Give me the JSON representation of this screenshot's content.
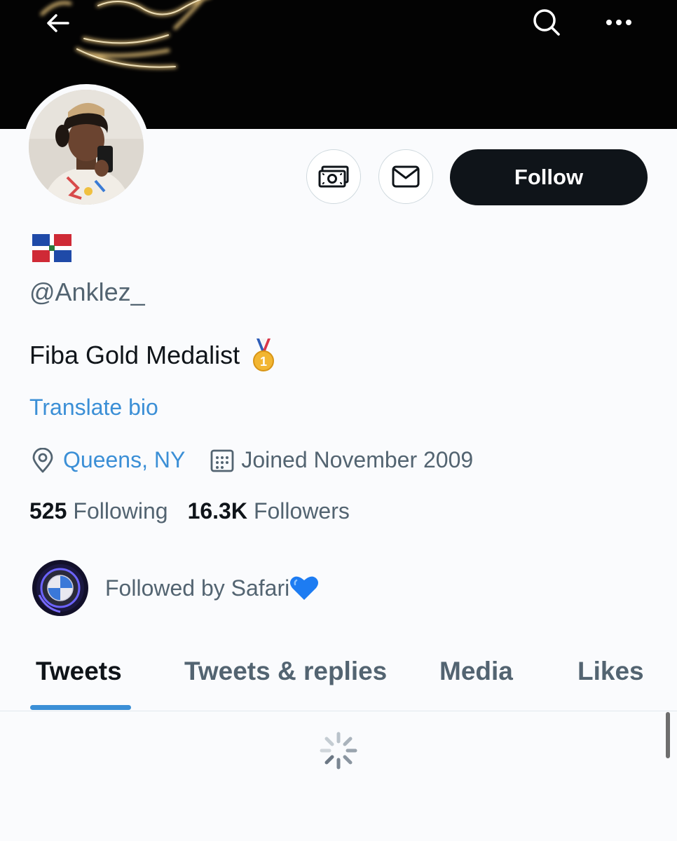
{
  "profile": {
    "handle": "@Anklez_",
    "bio": "Fiba Gold Medalist",
    "translate_label": "Translate bio",
    "location": "Queens, NY",
    "joined": "Joined November 2009",
    "following_count": "525",
    "following_label": "Following",
    "followers_count": "16.3K",
    "followers_label": "Followers",
    "followed_by": "Followed by Safari"
  },
  "actions": {
    "follow_label": "Follow"
  },
  "tabs": [
    {
      "label": "Tweets",
      "active": true
    },
    {
      "label": "Tweets & replies",
      "active": false
    },
    {
      "label": "Media",
      "active": false
    },
    {
      "label": "Likes",
      "active": false
    }
  ],
  "icons": {
    "back": "arrow-left-icon",
    "search": "search-icon",
    "more": "more-dots-icon",
    "tip": "money-icon",
    "message": "mail-icon",
    "location": "location-pin-icon",
    "calendar": "calendar-icon",
    "flag": "dominican-flag-icon",
    "medal": "gold-medal-icon",
    "heart": "blue-heart-icon",
    "loading": "spinner-icon"
  },
  "colors": {
    "link": "#3b8fd6",
    "follow_bg": "#0f1419",
    "muted_text": "#536471",
    "tab_indicator": "#3b8fd6"
  }
}
